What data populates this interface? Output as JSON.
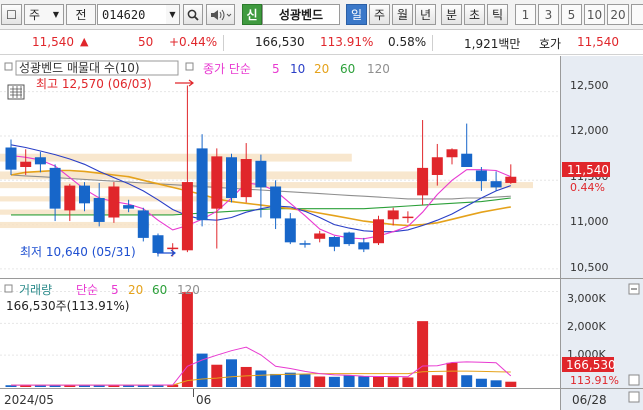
{
  "toolbar": {
    "market": "주",
    "prefix": "전",
    "code": "014620",
    "stock_name": "성광벤드",
    "periods": [
      "일",
      "주",
      "월",
      "년",
      "분",
      "초",
      "틱"
    ],
    "active_period": "일",
    "minute_options": [
      "1",
      "3",
      "5",
      "10",
      "20"
    ],
    "shin_label": "신"
  },
  "quote": {
    "price": "11,540",
    "direction": "▲",
    "change": "50",
    "change_pct": "+0.44%",
    "volume": "166,530",
    "volume_ratio": "113.91%",
    "turnover": "0.58%",
    "amount": "1,921백만",
    "bid_label": "호가",
    "bid_price": "11,540"
  },
  "price_panel": {
    "legend_title": "성광벤드 매물대 수(10)",
    "ma_label": "종가 단순",
    "ma_periods": [
      "5",
      "10",
      "20",
      "60",
      "120"
    ],
    "high_label": "최고 12,570 (06/03)",
    "low_label": "최저 10,640 (05/31)",
    "y_ticks": [
      "12,500",
      "12,000",
      "11,500",
      "11,000",
      "10,500"
    ],
    "current_price": "11,540",
    "current_pct": "0.44%"
  },
  "volume_panel": {
    "legend_title": "거래량",
    "ma_label": "단순",
    "ma_periods": [
      "5",
      "20",
      "60",
      "120"
    ],
    "info": "166,530주(113.91%)",
    "y_ticks": [
      "3,000K",
      "2,000K",
      "1,000K"
    ],
    "current_volume": "166,530",
    "current_pct": "113.91%"
  },
  "x_axis": {
    "labels": [
      "2024/05",
      "06",
      "06/28"
    ]
  },
  "colors": {
    "up": "#e0262b",
    "down": "#1766c9",
    "ma5": "#e83ad1",
    "ma10": "#2a3fc7",
    "ma20": "#e5a21b",
    "ma60": "#2ca03a",
    "ma120": "#8f8f8f",
    "volume_profile": "#f7e3c5"
  },
  "chart_data": {
    "type": "candlestick",
    "title": "성광벤드",
    "y_range": [
      10420,
      12880
    ],
    "candles": [
      {
        "open": 11870,
        "high": 11960,
        "low": 11560,
        "close": 11620
      },
      {
        "open": 11650,
        "high": 11850,
        "low": 11560,
        "close": 11710
      },
      {
        "open": 11760,
        "high": 11820,
        "low": 11590,
        "close": 11680
      },
      {
        "open": 11640,
        "high": 11680,
        "low": 11040,
        "close": 11180
      },
      {
        "open": 11160,
        "high": 11460,
        "low": 11040,
        "close": 11440
      },
      {
        "open": 11440,
        "high": 11480,
        "low": 11150,
        "close": 11240
      },
      {
        "open": 11300,
        "high": 11470,
        "low": 10980,
        "close": 11030
      },
      {
        "open": 11080,
        "high": 11480,
        "low": 11020,
        "close": 11430
      },
      {
        "open": 11220,
        "high": 11280,
        "low": 11140,
        "close": 11180
      },
      {
        "open": 11160,
        "high": 11190,
        "low": 10810,
        "close": 10850
      },
      {
        "open": 10880,
        "high": 10900,
        "low": 10640,
        "close": 10680
      },
      {
        "open": 10730,
        "high": 10790,
        "low": 10640,
        "close": 10740
      },
      {
        "open": 10710,
        "high": 12570,
        "low": 10690,
        "close": 11480
      },
      {
        "open": 11860,
        "high": 12020,
        "low": 10980,
        "close": 11050
      },
      {
        "open": 11180,
        "high": 11860,
        "low": 10730,
        "close": 11770
      },
      {
        "open": 11760,
        "high": 11800,
        "low": 11250,
        "close": 11300
      },
      {
        "open": 11310,
        "high": 11920,
        "low": 11250,
        "close": 11740
      },
      {
        "open": 11720,
        "high": 11790,
        "low": 11080,
        "close": 11420
      },
      {
        "open": 11430,
        "high": 11500,
        "low": 10950,
        "close": 11070
      },
      {
        "open": 11070,
        "high": 11130,
        "low": 10780,
        "close": 10800
      },
      {
        "open": 10790,
        "high": 10820,
        "low": 10740,
        "close": 10780
      },
      {
        "open": 10840,
        "high": 10930,
        "low": 10800,
        "close": 10900
      },
      {
        "open": 10860,
        "high": 10870,
        "low": 10700,
        "close": 10750
      },
      {
        "open": 10910,
        "high": 10920,
        "low": 10760,
        "close": 10780
      },
      {
        "open": 10800,
        "high": 10850,
        "low": 10690,
        "close": 10720
      },
      {
        "open": 10790,
        "high": 11100,
        "low": 10770,
        "close": 11060
      },
      {
        "open": 11060,
        "high": 11190,
        "low": 10990,
        "close": 11160
      },
      {
        "open": 11080,
        "high": 11150,
        "low": 11020,
        "close": 11090
      },
      {
        "open": 11330,
        "high": 12180,
        "low": 11220,
        "close": 11640
      },
      {
        "open": 11560,
        "high": 11910,
        "low": 11440,
        "close": 11760
      },
      {
        "open": 11760,
        "high": 11860,
        "low": 11680,
        "close": 11850
      },
      {
        "open": 11800,
        "high": 12140,
        "low": 11740,
        "close": 11650
      },
      {
        "open": 11610,
        "high": 11650,
        "low": 11380,
        "close": 11490
      },
      {
        "open": 11490,
        "high": 11600,
        "low": 11380,
        "close": 11420
      },
      {
        "open": 11470,
        "high": 11680,
        "low": 11460,
        "close": 11540
      }
    ],
    "volume_profile": [
      {
        "low": 11700,
        "high": 11800,
        "rel": 0.66
      },
      {
        "low": 11500,
        "high": 11600,
        "rel": 0.8
      },
      {
        "low": 11400,
        "high": 11480,
        "rel": 1.0
      },
      {
        "low": 11250,
        "high": 11320,
        "rel": 0.44
      },
      {
        "low": 11100,
        "high": 11170,
        "rel": 0.34
      },
      {
        "low": 10950,
        "high": 11030,
        "rel": 0.28
      }
    ],
    "ma": {
      "ma5": [
        11780,
        11760,
        11730,
        11660,
        11530,
        11400,
        11300,
        11260,
        11230,
        11180,
        11050,
        10940,
        10990,
        11060,
        11150,
        11300,
        11470,
        11450,
        11380,
        11240,
        11100,
        10950,
        10880,
        10850,
        10840,
        10870,
        10920,
        10980,
        11140,
        11340,
        11500,
        11620,
        11620,
        11610,
        11540
      ],
      "ma10": [
        11900,
        11870,
        11830,
        11790,
        11740,
        11680,
        11600,
        11530,
        11460,
        11380,
        11280,
        11170,
        11100,
        11060,
        11050,
        11080,
        11140,
        11180,
        11210,
        11200,
        11150,
        11080,
        11000,
        10960,
        10930,
        10920,
        10920,
        10940,
        10990,
        11050,
        11120,
        11210,
        11300,
        11380,
        11440
      ],
      "ma20": [
        11560,
        11590,
        11600,
        11610,
        11610,
        11600,
        11580,
        11560,
        11540,
        11500,
        11460,
        11420,
        11380,
        11340,
        11290,
        11260,
        11240,
        11220,
        11200,
        11180,
        11160,
        11130,
        11100,
        11070,
        11040,
        11020,
        11000,
        10990,
        11000,
        11020,
        11060,
        11100,
        11140,
        11170,
        11200
      ],
      "ma60": [
        11110,
        11110,
        11110,
        11110,
        11110,
        11110,
        11110,
        11110,
        11110,
        11110,
        11110,
        11110,
        11120,
        11130,
        11140,
        11150,
        11160,
        11170,
        11180,
        11180,
        11180,
        11180,
        11180,
        11180,
        11180,
        11190,
        11200,
        11210,
        11220,
        11230,
        11240,
        11250,
        11260,
        11280,
        11300
      ],
      "ma120": [
        11560,
        11550,
        11540,
        11530,
        11520,
        11510,
        11500,
        11490,
        11480,
        11470,
        11460,
        11450,
        11440,
        11430,
        11420,
        11410,
        11400,
        11390,
        11380,
        11370,
        11360,
        11350,
        11340,
        11330,
        11320,
        11310,
        11300,
        11290,
        11290,
        11290,
        11290,
        11300,
        11300,
        11310,
        11320
      ]
    },
    "volume": {
      "y_range": [
        0,
        3300
      ],
      "unit": "K",
      "values": [
        55,
        60,
        58,
        60,
        58,
        60,
        56,
        62,
        60,
        58,
        60,
        75,
        2980,
        1050,
        700,
        870,
        630,
        520,
        410,
        450,
        400,
        330,
        320,
        360,
        330,
        320,
        310,
        300,
        2070,
        370,
        760,
        370,
        260,
        210,
        166.53
      ],
      "ma5": [
        60,
        60,
        60,
        60,
        60,
        60,
        60,
        60,
        60,
        60,
        62,
        64,
        650,
        850,
        1000,
        1140,
        1250,
        1010,
        650,
        580,
        490,
        420,
        380,
        370,
        340,
        330,
        330,
        320,
        660,
        670,
        770,
        790,
        780,
        760,
        350
      ],
      "ma20": [
        60,
        60,
        60,
        60,
        60,
        60,
        60,
        60,
        60,
        60,
        60,
        60,
        200,
        250,
        280,
        320,
        350,
        370,
        390,
        400,
        410,
        420,
        420,
        420,
        420,
        420,
        420,
        420,
        480,
        490,
        500,
        500,
        490,
        480,
        470
      ]
    }
  }
}
